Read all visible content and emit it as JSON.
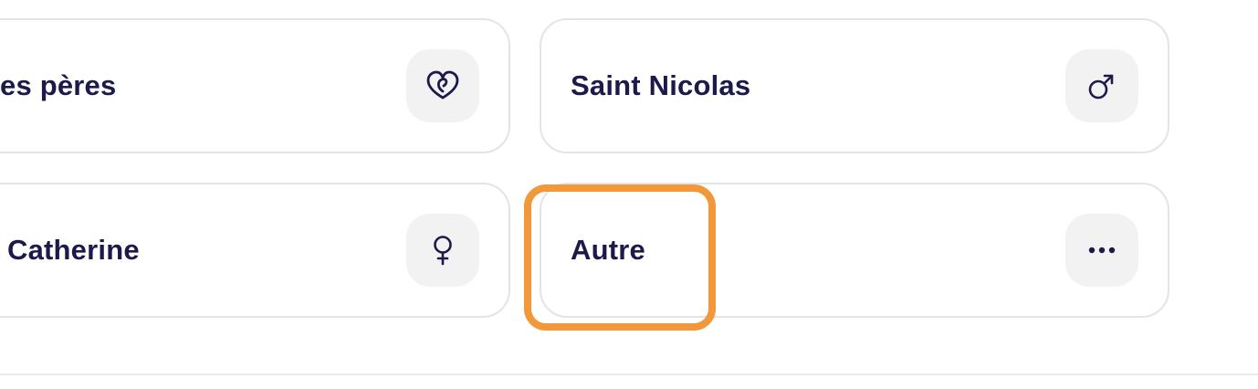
{
  "options": [
    {
      "label": "es pères",
      "icon": "heart-loop-icon"
    },
    {
      "label": "Saint Nicolas",
      "icon": "male-symbol-icon"
    },
    {
      "label": "Catherine",
      "icon": "female-symbol-icon"
    },
    {
      "label": "Autre",
      "icon": "ellipsis-icon",
      "focused": true
    }
  ],
  "colors": {
    "text": "#1c1a4a",
    "card_border": "#e4e4e7",
    "icon_background": "#f2f2f3",
    "focus_ring": "#f0983a"
  }
}
